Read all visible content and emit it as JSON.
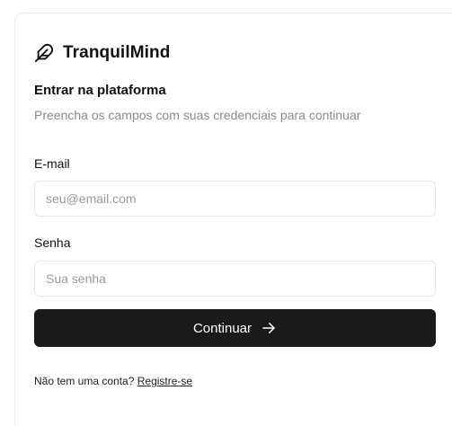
{
  "brand": {
    "name": "TranquilMind",
    "icon": "feather-icon"
  },
  "form": {
    "heading": "Entrar na plataforma",
    "subheading": "Preencha os campos com suas credenciais para continuar",
    "email": {
      "label": "E-mail",
      "placeholder": "seu@email.com",
      "value": ""
    },
    "password": {
      "label": "Senha",
      "placeholder": "Sua senha",
      "value": ""
    },
    "submit": {
      "label": "Continuar",
      "icon": "arrow-right-icon"
    }
  },
  "footer": {
    "prompt": "Não tem uma conta?",
    "register_link": "Registre-se"
  },
  "colors": {
    "button_bg": "#1a1a1a",
    "muted_text": "#8a8a8a",
    "border": "#e6e6e6"
  }
}
